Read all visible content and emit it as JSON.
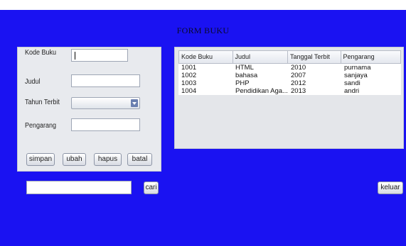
{
  "title": "FORM BUKU",
  "form": {
    "kode_label": "Kode Buku",
    "kode_value": "",
    "judul_label": "Judul",
    "judul_value": "",
    "tahun_label": "Tahun Terbit",
    "tahun_selected": "",
    "pengarang_label": "Pengarang",
    "pengarang_value": "",
    "buttons": {
      "simpan": "simpan",
      "ubah": "ubah",
      "hapus": "hapus",
      "batal": "batal"
    }
  },
  "table": {
    "headers": [
      "Kode Buku",
      "Judul",
      "Tanggal Terbit",
      "Pengarang"
    ],
    "rows": [
      [
        "1001",
        "HTML",
        "2010",
        "purnama"
      ],
      [
        "1002",
        "bahasa",
        "2007",
        "sanjaya"
      ],
      [
        "1003",
        "PHP",
        "2012",
        "sandi"
      ],
      [
        "1004",
        "Pendidikan Aga...",
        "2013",
        "andri"
      ]
    ]
  },
  "search": {
    "value": "",
    "button_label": "cari"
  },
  "exit_button_label": "keluar",
  "colors": {
    "background": "#1a12f2",
    "panel": "#e8eaee"
  }
}
